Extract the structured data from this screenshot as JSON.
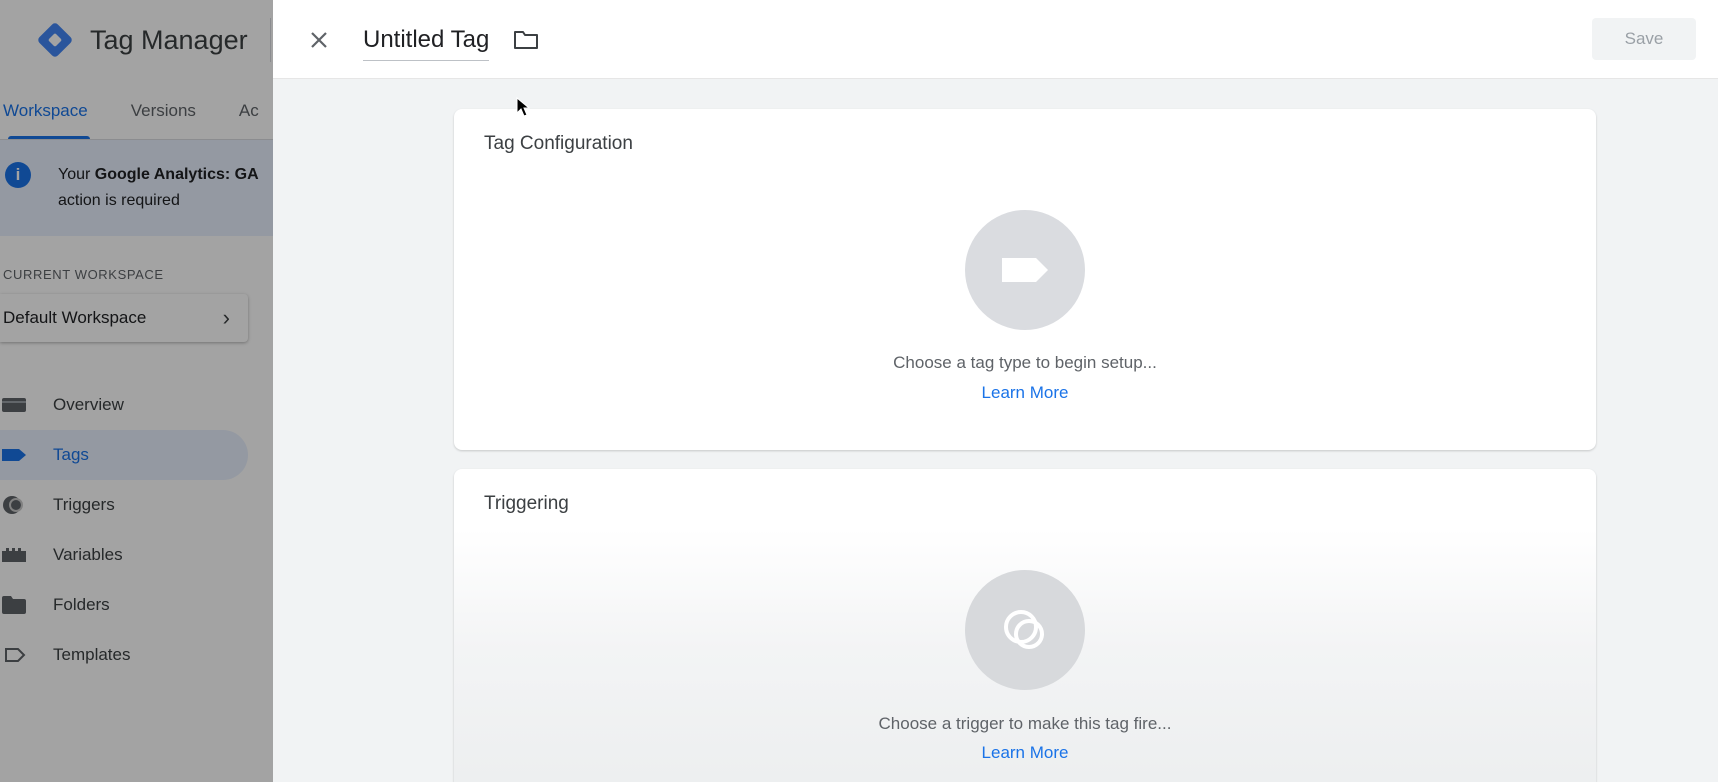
{
  "app": {
    "title": "Tag Manager",
    "tabs": [
      {
        "label": "Workspace",
        "active": true
      },
      {
        "label": "Versions",
        "active": false
      },
      {
        "label": "Ac",
        "active": false
      }
    ],
    "notice": {
      "prefix": "Your ",
      "bold": "Google Analytics: GA",
      "line2": "action is required"
    },
    "current_workspace_label": "CURRENT WORKSPACE",
    "current_workspace_name": "Default Workspace",
    "nav": [
      {
        "label": "Overview",
        "icon": "overview-icon",
        "active": false
      },
      {
        "label": "Tags",
        "icon": "tag-icon",
        "active": true
      },
      {
        "label": "Triggers",
        "icon": "trigger-icon",
        "active": false
      },
      {
        "label": "Variables",
        "icon": "variables-icon",
        "active": false
      },
      {
        "label": "Folders",
        "icon": "folder-icon",
        "active": false
      },
      {
        "label": "Templates",
        "icon": "template-icon",
        "active": false
      }
    ]
  },
  "editor": {
    "tag_name": "Untitled Tag",
    "save_label": "Save",
    "tag_config": {
      "title": "Tag Configuration",
      "hint": "Choose a tag type to begin setup...",
      "learn_more": "Learn More"
    },
    "triggering": {
      "title": "Triggering",
      "hint": "Choose a trigger to make this tag fire...",
      "learn_more": "Learn More"
    }
  },
  "colors": {
    "accent": "#1a73e8",
    "placeholder_circle": "#dadce0"
  }
}
